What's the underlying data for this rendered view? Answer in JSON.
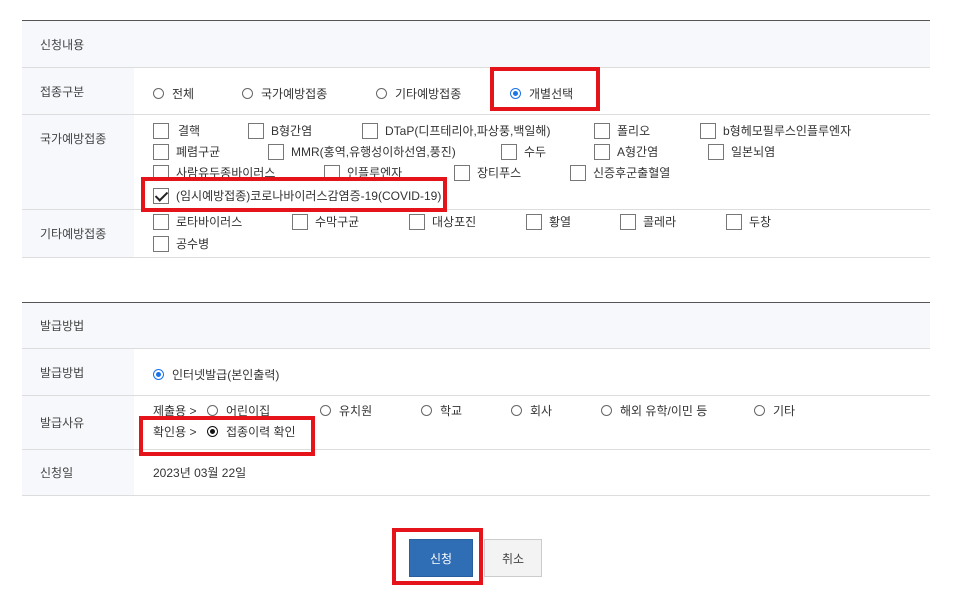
{
  "section1": {
    "title": "신청내용",
    "vaccination_type": {
      "label": "접종구분",
      "options": [
        "전체",
        "국가예방접종",
        "기타예방접종",
        "개별선택"
      ],
      "selected": "개별선택"
    },
    "national": {
      "label": "국가예방접종",
      "items": [
        "결핵",
        "B형간염",
        "DTaP(디프테리아,파상풍,백일해)",
        "폴리오",
        "b형헤모필루스인플루엔자",
        "폐렴구균",
        "MMR(홍역,유행성이하선염,풍진)",
        "수두",
        "A형간염",
        "일본뇌염",
        "사람유두종바이러스",
        "인플루엔자",
        "장티푸스",
        "신증후군출혈열",
        "(임시예방접종)코로나바이러스감염증-19(COVID-19)"
      ],
      "checked": "(임시예방접종)코로나바이러스감염증-19(COVID-19)"
    },
    "other": {
      "label": "기타예방접종",
      "items": [
        "로타바이러스",
        "수막구균",
        "대상포진",
        "황열",
        "콜레라",
        "두창",
        "공수병"
      ]
    }
  },
  "section2": {
    "title": "발급방법",
    "method": {
      "label": "발급방법",
      "option": "인터넷발급(본인출력)"
    },
    "reason": {
      "label": "발급사유",
      "submit_prefix": "제출용 >",
      "options": [
        "어린이집",
        "유치원",
        "학교",
        "회사",
        "해외 유학/이민 등",
        "기타"
      ],
      "confirm_prefix": "확인용 >",
      "confirm_option": "접종이력 확인"
    },
    "date": {
      "label": "신청일",
      "value": "2023년 03월 22일"
    }
  },
  "buttons": {
    "submit": "신청",
    "cancel": "취소"
  },
  "colors": {
    "accent": "#1a73e8",
    "primary_button": "#2f6db5",
    "highlight": "#e5141b"
  }
}
